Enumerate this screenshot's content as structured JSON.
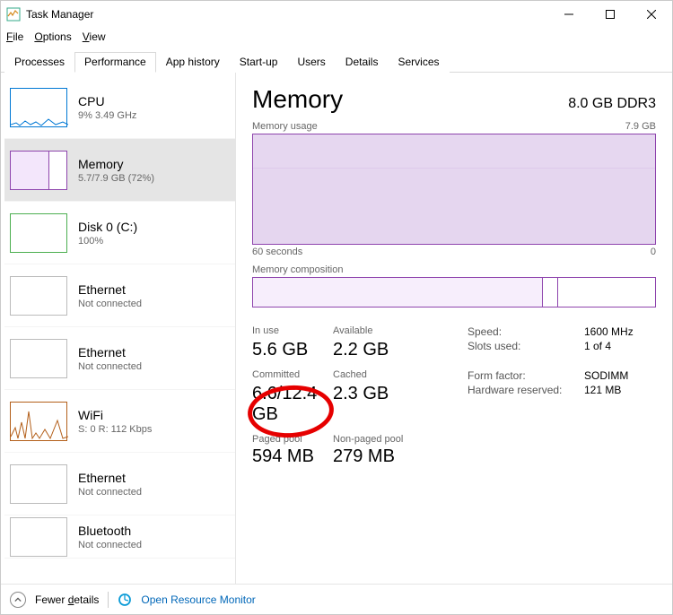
{
  "window": {
    "title": "Task Manager"
  },
  "menu": {
    "file": "File",
    "options": "Options",
    "view": "View"
  },
  "tabs": {
    "processes": "Processes",
    "performance": "Performance",
    "app_history": "App history",
    "startup": "Start-up",
    "users": "Users",
    "details": "Details",
    "services": "Services"
  },
  "sidebar": [
    {
      "name": "CPU",
      "sub": "9%  3.49 GHz",
      "kind": "cpu"
    },
    {
      "name": "Memory",
      "sub": "5.7/7.9 GB (72%)",
      "kind": "mem",
      "selected": true
    },
    {
      "name": "Disk 0 (C:)",
      "sub": "100%",
      "kind": "disk"
    },
    {
      "name": "Ethernet",
      "sub": "Not connected",
      "kind": "eth"
    },
    {
      "name": "Ethernet",
      "sub": "Not connected",
      "kind": "eth"
    },
    {
      "name": "WiFi",
      "sub": "S: 0  R: 112 Kbps",
      "kind": "wifi"
    },
    {
      "name": "Ethernet",
      "sub": "Not connected",
      "kind": "eth"
    },
    {
      "name": "Bluetooth",
      "sub": "Not connected",
      "kind": "bt"
    }
  ],
  "memory": {
    "title": "Memory",
    "spec": "8.0 GB DDR3",
    "usage_label": "Memory usage",
    "usage_max": "7.9 GB",
    "axis_left": "60 seconds",
    "axis_right": "0",
    "comp_label": "Memory composition",
    "stats": {
      "in_use_label": "In use",
      "in_use": "5.6 GB",
      "available_label": "Available",
      "available": "2.2 GB",
      "committed_label": "Committed",
      "committed": "6.6/12.4 GB",
      "cached_label": "Cached",
      "cached": "2.3 GB",
      "paged_label": "Paged pool",
      "paged": "594 MB",
      "nonpaged_label": "Non-paged pool",
      "nonpaged": "279 MB",
      "speed_label": "Speed:",
      "speed": "1600 MHz",
      "slots_label": "Slots used:",
      "slots": "1 of 4",
      "form_label": "Form factor:",
      "form": "SODIMM",
      "hw_label": "Hardware reserved:",
      "hw": "121 MB"
    }
  },
  "footer": {
    "fewer": "Fewer details",
    "rm": "Open Resource Monitor"
  }
}
